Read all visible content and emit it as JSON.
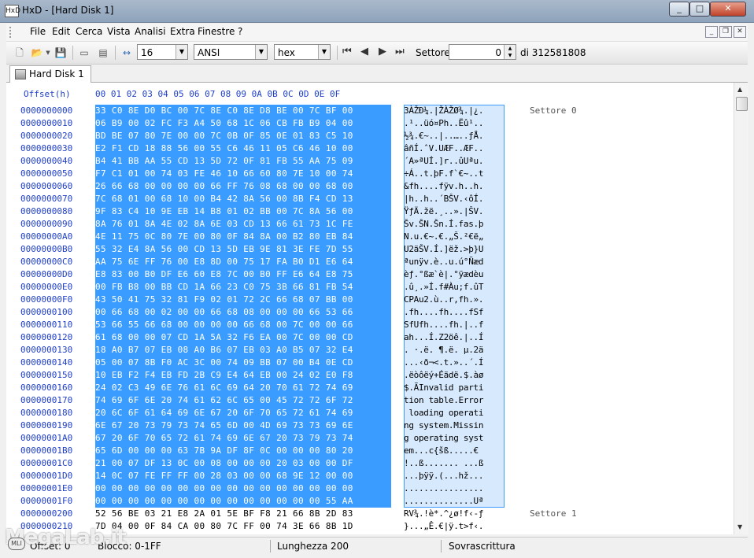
{
  "window": {
    "title": "HxD - [Hard Disk 1]",
    "app_icon": "HxD"
  },
  "menu": [
    "File",
    "Edit",
    "Cerca",
    "Vista",
    "Analisi",
    "Extra",
    "Finestre",
    "?"
  ],
  "toolbar": {
    "bytes_per_row": "16",
    "charset": "ANSI",
    "offset_base": "hex",
    "sector_label": "Settore",
    "sector_value": "0",
    "sector_total": "di 312581808"
  },
  "tab": {
    "label": "Hard Disk 1"
  },
  "editor": {
    "offset_header": "Offset(h)",
    "columns": [
      "00",
      "01",
      "02",
      "03",
      "04",
      "05",
      "06",
      "07",
      "08",
      "09",
      "0A",
      "0B",
      "0C",
      "0D",
      "0E",
      "0F"
    ],
    "rows": [
      {
        "off": "0000000000",
        "hex": "33 C0 8E D0 BC 00 7C 8E C0 8E D8 BE 00 7C BF 00",
        "ascii": "3ÀŽÐ¼.|ŽÀŽØ¾.|¿."
      },
      {
        "off": "0000000010",
        "hex": "06 B9 00 02 FC F3 A4 50 68 1C 06 CB FB B9 04 00",
        "ascii": ".¹..üó¤Ph..Ëû¹.."
      },
      {
        "off": "0000000020",
        "hex": "BD BE 07 80 7E 00 00 7C 0B 0F 85 0E 01 83 C5 10",
        "ascii": "½¾.€~..|..…..ƒÅ."
      },
      {
        "off": "0000000030",
        "hex": "E2 F1 CD 18 88 56 00 55 C6 46 11 05 C6 46 10 00",
        "ascii": "âñÍ.ˆV.UÆF..ÆF.."
      },
      {
        "off": "0000000040",
        "hex": "B4 41 BB AA 55 CD 13 5D 72 0F 81 FB 55 AA 75 09",
        "ascii": "´A»ªUÍ.]r..ûUªu."
      },
      {
        "off": "0000000050",
        "hex": "F7 C1 01 00 74 03 FE 46 10 66 60 80 7E 10 00 74",
        "ascii": "÷Á..t.þF.f`€~..t"
      },
      {
        "off": "0000000060",
        "hex": "26 66 68 00 00 00 00 66 FF 76 08 68 00 00 68 00",
        "ascii": "&fh....fÿv.h..h."
      },
      {
        "off": "0000000070",
        "hex": "7C 68 01 00 68 10 00 B4 42 8A 56 00 8B F4 CD 13",
        "ascii": "|h..h..´BŠV.‹ôÍ."
      },
      {
        "off": "0000000080",
        "hex": "9F 83 C4 10 9E EB 14 B8 01 02 BB 00 7C 8A 56 00",
        "ascii": "ŸƒÄ.žë.¸..».|ŠV."
      },
      {
        "off": "0000000090",
        "hex": "8A 76 01 8A 4E 02 8A 6E 03 CD 13 66 61 73 1C FE",
        "ascii": "Šv.ŠN.Šn.Í.fas.þ"
      },
      {
        "off": "00000000A0",
        "hex": "4E 11 75 0C 80 7E 00 80 0F 84 8A 00 B2 80 EB 84",
        "ascii": "N.u.€~.€.„Š.²€ë„"
      },
      {
        "off": "00000000B0",
        "hex": "55 32 E4 8A 56 00 CD 13 5D EB 9E 81 3E FE 7D 55",
        "ascii": "U2äŠV.Í.]ëž.>þ}U"
      },
      {
        "off": "00000000C0",
        "hex": "AA 75 6E FF 76 00 E8 8D 00 75 17 FA B0 D1 E6 64",
        "ascii": "ªunÿv.è..u.ú°Ñæd"
      },
      {
        "off": "00000000D0",
        "hex": "E8 83 00 B0 DF E6 60 E8 7C 00 B0 FF E6 64 E8 75",
        "ascii": "èƒ.°ßæ`è|.°ÿædèu"
      },
      {
        "off": "00000000E0",
        "hex": "00 FB B8 00 BB CD 1A 66 23 C0 75 3B 66 81 FB 54",
        "ascii": ".û¸.»Í.f#Àu;f.ûT"
      },
      {
        "off": "00000000F0",
        "hex": "43 50 41 75 32 81 F9 02 01 72 2C 66 68 07 BB 00",
        "ascii": "CPAu2.ù..r,fh.»."
      },
      {
        "off": "0000000100",
        "hex": "00 66 68 00 02 00 00 66 68 08 00 00 00 66 53 66",
        "ascii": ".fh....fh....fSf"
      },
      {
        "off": "0000000110",
        "hex": "53 66 55 66 68 00 00 00 00 66 68 00 7C 00 00 66",
        "ascii": "SfUfh....fh.|..f"
      },
      {
        "off": "0000000120",
        "hex": "61 68 00 00 07 CD 1A 5A 32 F6 EA 00 7C 00 00 CD",
        "ascii": "ah...Í.Z2öê.|..Í"
      },
      {
        "off": "0000000130",
        "hex": "18 A0 B7 07 EB 08 A0 B6 07 EB 03 A0 B5 07 32 E4",
        "ascii": ". ·.ë. ¶.ë. µ.2ä"
      },
      {
        "off": "0000000140",
        "hex": "05 00 07 8B F0 AC 3C 00 74 09 BB 07 00 B4 0E CD",
        "ascii": "...‹ð¬<.t.»..´.Í"
      },
      {
        "off": "0000000150",
        "hex": "10 EB F2 F4 EB FD 2B C9 E4 64 EB 00 24 02 E0 F8",
        "ascii": ".ëòôëý+Éädë.$.àø"
      },
      {
        "off": "0000000160",
        "hex": "24 02 C3 49 6E 76 61 6C 69 64 20 70 61 72 74 69",
        "ascii": "$.ÃInvalid parti"
      },
      {
        "off": "0000000170",
        "hex": "74 69 6F 6E 20 74 61 62 6C 65 00 45 72 72 6F 72",
        "ascii": "tion table.Error"
      },
      {
        "off": "0000000180",
        "hex": "20 6C 6F 61 64 69 6E 67 20 6F 70 65 72 61 74 69",
        "ascii": " loading operati"
      },
      {
        "off": "0000000190",
        "hex": "6E 67 20 73 79 73 74 65 6D 00 4D 69 73 73 69 6E",
        "ascii": "ng system.Missin"
      },
      {
        "off": "00000001A0",
        "hex": "67 20 6F 70 65 72 61 74 69 6E 67 20 73 79 73 74",
        "ascii": "g operating syst"
      },
      {
        "off": "00000001B0",
        "hex": "65 6D 00 00 00 63 7B 9A DF 8F 0C 00 00 00 80 20",
        "ascii": "em...c{šß.....€ "
      },
      {
        "off": "00000001C0",
        "hex": "21 00 07 DF 13 0C 00 08 00 00 00 20 03 00 00 DF",
        "ascii": "!..ß....... ...ß"
      },
      {
        "off": "00000001D0",
        "hex": "14 0C 07 FE FF FF 00 28 03 00 00 68 9E 12 00 00",
        "ascii": "...þÿÿ.(...hž..."
      },
      {
        "off": "00000001E0",
        "hex": "00 00 00 00 00 00 00 00 00 00 00 00 00 00 00 00",
        "ascii": "................"
      },
      {
        "off": "00000001F0",
        "hex": "00 00 00 00 00 00 00 00 00 00 00 00 00 00 55 AA",
        "ascii": "..............Uª"
      },
      {
        "off": "0000000200",
        "hex": "52 56 BE 03 21 E8 2A 01 5E BF F8 21 66 8B 2D 83",
        "ascii": "RV¾.!è*.^¿ø!f‹-ƒ"
      },
      {
        "off": "0000000210",
        "hex": "7D 04 00 0F 84 CA 00 80 7C FF 00 74 3E 66 8B 1D",
        "ascii": "}...„Ê.€|ÿ.t>f‹."
      }
    ],
    "sector_labels": [
      "Settore 0",
      "Settore 1"
    ]
  },
  "status": {
    "offset": "Offset: 0",
    "block": "Blocco: 0-1FF",
    "length": "Lunghezza 200",
    "mode": "Sovrascrittura"
  },
  "watermark": {
    "text": "MegaLab.it",
    "badge": "MLI"
  },
  "colors": {
    "selection": "#3b9cff",
    "ascii_selection": "#d7e9fd",
    "offset_text": "#1f3fc9"
  }
}
